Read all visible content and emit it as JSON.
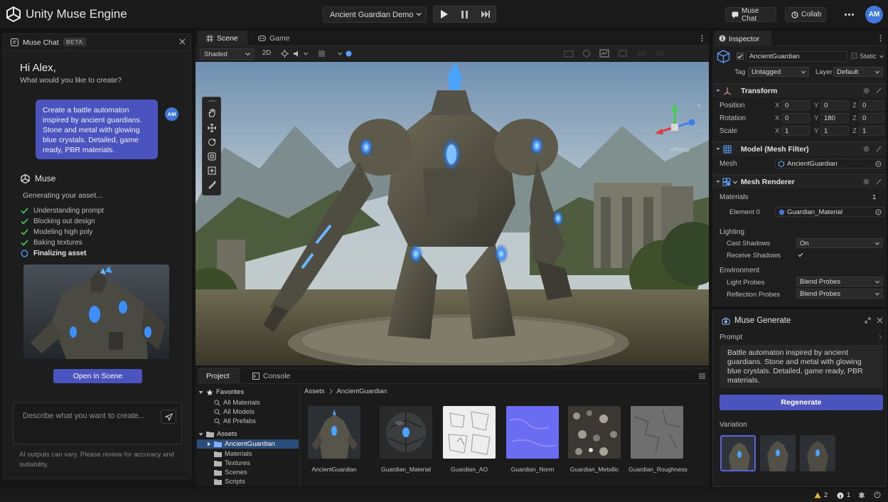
{
  "app": {
    "title": "Unity Muse Engine",
    "scene_selector": "Ancient Guardian Demo"
  },
  "topbar": {
    "muse_chat_label": "Muse Chat",
    "collab_label": "Collab",
    "avatar_initials": "AM"
  },
  "chat": {
    "title": "Muse Chat",
    "badge": "BETA",
    "greeting": "Hi Alex,",
    "subgreeting": "What would you like to create?",
    "user_message": "Create a battle automaton inspired by ancient guardians. Stone and metal with glowing blue crystals. Detailed, game ready, PBR materials.",
    "user_initials": "AM",
    "assistant_name": "Muse",
    "status": "Generating your asset...",
    "steps": [
      {
        "label": "Understanding prompt",
        "done": true
      },
      {
        "label": "Blocking out design",
        "done": true
      },
      {
        "label": "Modeling high poly",
        "done": true
      },
      {
        "label": "Baking textures",
        "done": true
      },
      {
        "label": "Finalizing asset",
        "done": false
      }
    ],
    "open_in_scene": "Open in Scene",
    "input_placeholder": "Describe what you want to create...",
    "disclaimer": "AI outputs can vary. Please review for accuracy and suitability."
  },
  "scene": {
    "tabs": [
      "Scene",
      "Game"
    ],
    "shading": "Shaded",
    "mode_2d": "2D",
    "persp_label": "<Persp"
  },
  "project": {
    "tabs": [
      "Project",
      "Console"
    ],
    "tree": {
      "favorites": "Favorites",
      "favorite_items": [
        "All Materials",
        "All Models",
        "All Prefabs"
      ],
      "assets": "Assets",
      "asset_folders": [
        "AncientGuardian",
        "Materials",
        "Textures",
        "Scenes",
        "Scripts"
      ]
    },
    "breadcrumb": [
      "Assets",
      "AncientGuardian"
    ],
    "items": [
      "AncientGuardian",
      "Guardian_Material",
      "Guardian_AO",
      "Guardian_Norm",
      "Guardian_Metallic",
      "Guardian_Roughness"
    ]
  },
  "inspector": {
    "title": "Inspector",
    "object_name": "AncientGuardian",
    "static_label": "Static",
    "tag_label": "Tag",
    "tag_value": "Untagged",
    "layer_label": "Layer",
    "layer_value": "Default",
    "transform": {
      "title": "Transform",
      "position": {
        "label": "Position",
        "x": "0",
        "y": "0",
        "z": "0"
      },
      "rotation": {
        "label": "Rotation",
        "x": "0",
        "y": "180",
        "z": "0"
      },
      "scale": {
        "label": "Scale",
        "x": "1",
        "y": "1",
        "z": "1"
      }
    },
    "mesh_filter": {
      "title": "Model (Mesh Filter)",
      "mesh_label": "Mesh",
      "mesh_value": "AncientGuardian"
    },
    "mesh_renderer": {
      "title": "Mesh Renderer",
      "materials_label": "Materials",
      "materials_count": "1",
      "element_label": "Element 0",
      "element_value": "Guardian_Material",
      "lighting_label": "Lighting",
      "cast_shadows_label": "Cast Shadows",
      "cast_shadows_value": "On",
      "receive_shadows_label": "Receive Shadows",
      "environment_label": "Environment",
      "light_probes_label": "Light Probes",
      "light_probes_value": "Blend Probes",
      "reflection_probes_label": "Reflection Probes",
      "reflection_probes_value": "Blend Probes"
    }
  },
  "muse_generate": {
    "title": "Muse Generate",
    "prompt_label": "Prompt",
    "prompt_text": "Battle automaton inspired by ancient guardians. Stone and metal with glowing blue crystals. Detailed, game ready, PBR materials.",
    "regenerate": "Regenerate",
    "variation_label": "Variation"
  },
  "status": {
    "warnings": "2",
    "errors": "1"
  },
  "colors": {
    "accent": "#4b53bf",
    "avatar": "#3f78d8",
    "check": "#3fbf5a",
    "crystal": "#4aa3ff"
  }
}
